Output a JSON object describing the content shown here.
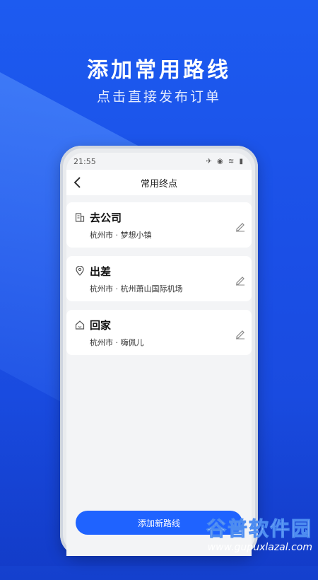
{
  "banner": {
    "headline": "添加常用路线",
    "subline": "点击直接发布订单"
  },
  "phone": {
    "status_time": "21:55",
    "status_icons": "✈ ◉ ≋ ▮",
    "nav_title": "常用终点",
    "routes": [
      {
        "name": "去公司",
        "address": "杭州市 · 梦想小镇",
        "icon": "building-icon"
      },
      {
        "name": "出差",
        "address": "杭州市 · 杭州萧山国际机场",
        "icon": "location-pin-icon"
      },
      {
        "name": "回家",
        "address": "杭州市 · 嗨佩儿",
        "icon": "home-icon"
      }
    ],
    "add_button_label": "添加新路线"
  },
  "watermark": {
    "title": "谷普软件园",
    "url": "www.gupuxlazal.com"
  },
  "colors": {
    "background": "#1b4fe6",
    "accent": "#1f63ff",
    "card": "#ffffff",
    "screen": "#f3f4f6"
  }
}
